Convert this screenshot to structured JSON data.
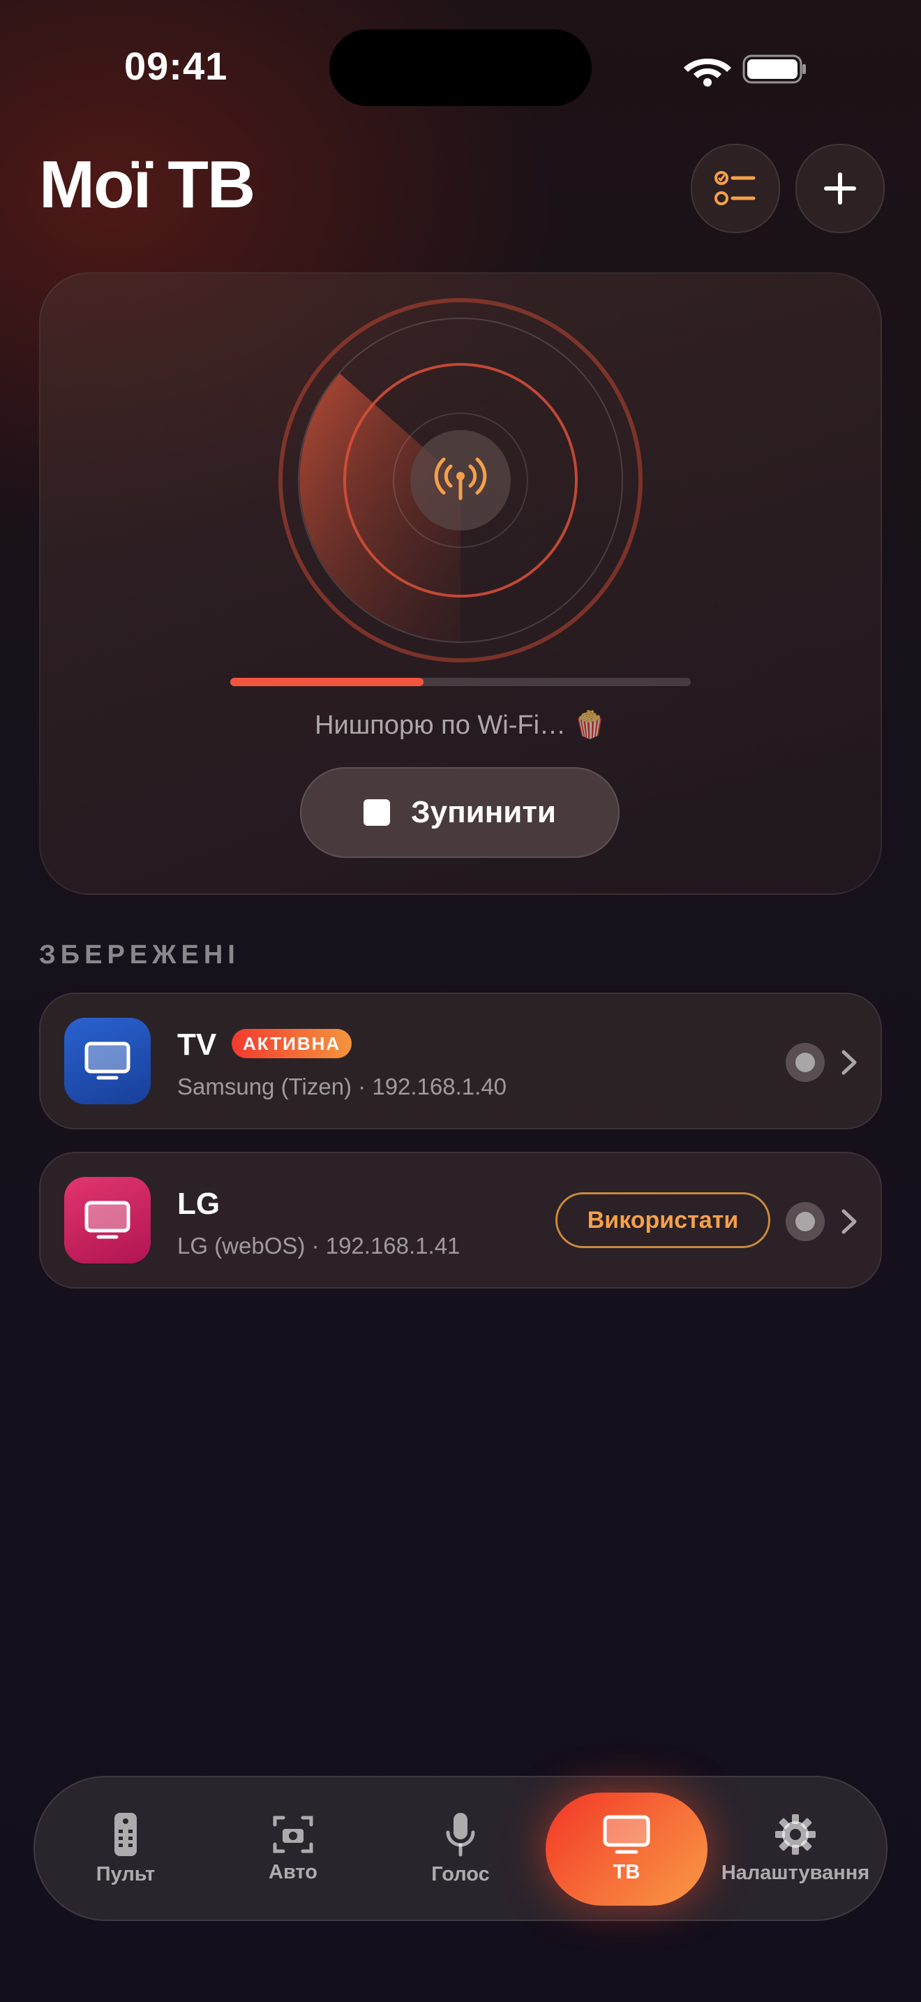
{
  "status_bar": {
    "time": "09:41",
    "icons": [
      "wifi-icon",
      "battery-icon"
    ]
  },
  "header": {
    "title": "Мої ТВ",
    "buttons": [
      "checklist-icon",
      "plus-icon"
    ]
  },
  "scan": {
    "progress": 0.42,
    "status_text": "Нишпорю по Wi-Fi… 🍿",
    "stop_label": "Зупинити"
  },
  "saved": {
    "section_label": "ЗБЕРЕЖЕНІ",
    "devices": [
      {
        "name": "TV",
        "badge": "АКТИВНА",
        "subtitle": "Samsung (Tizen) · 192.168.1.40",
        "color": "#2058c4"
      },
      {
        "name": "LG",
        "action_label": "Використати",
        "subtitle": "LG (webOS) · 192.168.1.41",
        "color": "#d11f5f"
      }
    ]
  },
  "tabbar": {
    "tabs": [
      {
        "label": "Пульт",
        "icon": "remote-icon"
      },
      {
        "label": "Авто",
        "icon": "camera-scan-icon"
      },
      {
        "label": "Голос",
        "icon": "microphone-icon"
      },
      {
        "label": "ТВ",
        "icon": "tv-icon",
        "active": true
      },
      {
        "label": "Налаштування",
        "icon": "gear-icon"
      }
    ]
  },
  "colors": {
    "accent": "#f2553d",
    "accent_orange": "#f5a04a"
  }
}
